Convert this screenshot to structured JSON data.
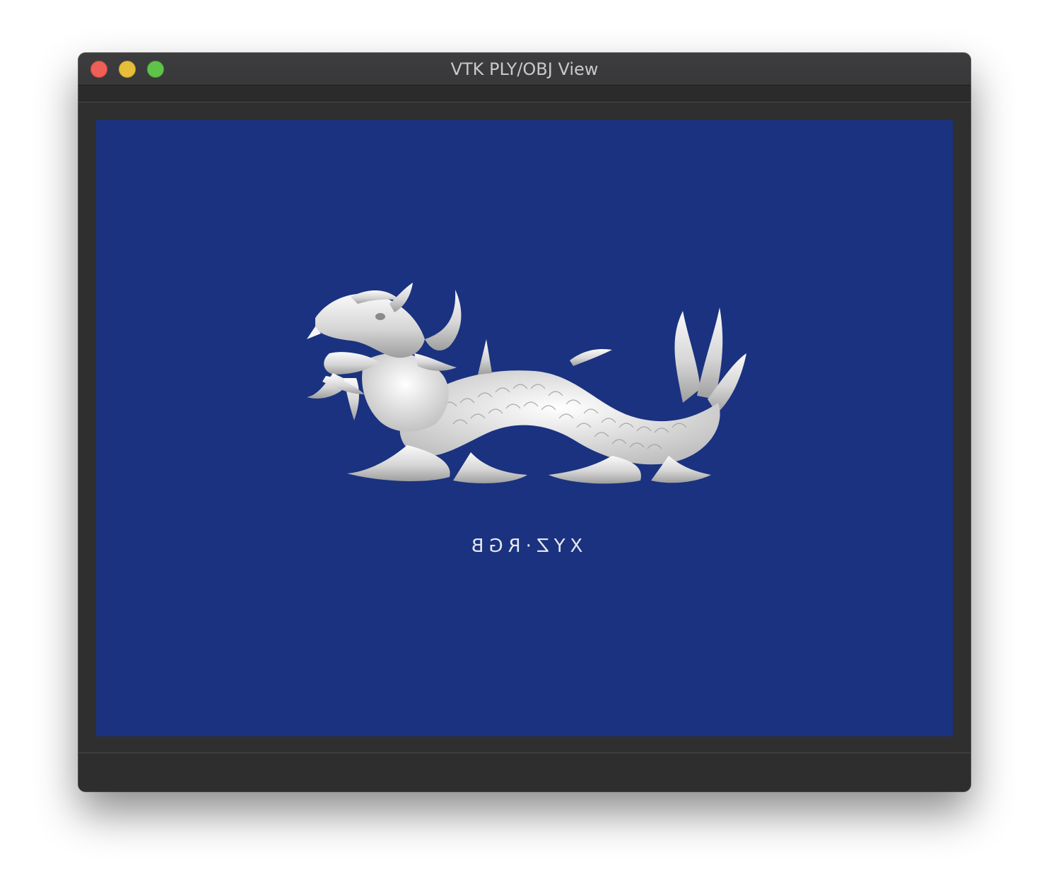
{
  "window": {
    "title": "VTK PLY/OBJ View"
  },
  "viewport": {
    "background_color": "#1a327f",
    "model_color": "#e9e9e9",
    "overlay_text": "XYZ·RGB"
  },
  "controls": {
    "close_icon": "close-icon",
    "minimize_icon": "minimize-icon",
    "zoom_icon": "zoom-icon"
  }
}
